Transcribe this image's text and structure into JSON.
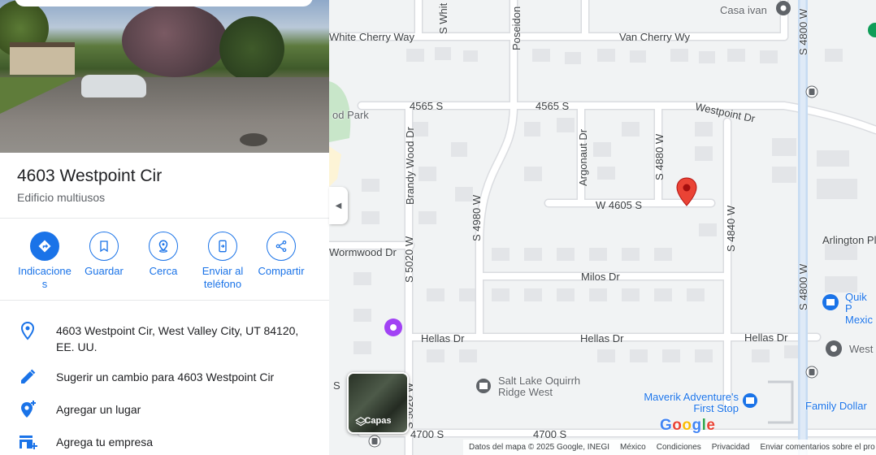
{
  "place": {
    "title": "4603 Westpoint Cir",
    "subtitle": "Edificio multiusos",
    "photo": "street-view-photo"
  },
  "actions": [
    {
      "label": "Indicaciones",
      "icon": "directions-icon"
    },
    {
      "label": "Guardar",
      "icon": "bookmark-icon"
    },
    {
      "label": "Cerca",
      "icon": "nearby-icon"
    },
    {
      "label": "Enviar al teléfono",
      "icon": "send-to-phone-icon"
    },
    {
      "label": "Compartir",
      "icon": "share-icon"
    }
  ],
  "info": {
    "address": "4603 Westpoint Cir, West Valley City, UT 84120, EE. UU.",
    "suggest_edit": "Sugerir un cambio para 4603 Westpoint Cir",
    "add_place": "Agregar un lugar",
    "add_business": "Agrega tu empresa"
  },
  "map": {
    "streets": {
      "white_cherry": "White Cherry Way",
      "van_cherry": "Van Cherry Wy",
      "s4565_a": "4565 S",
      "s4565_b": "4565 S",
      "westpoint": "Westpoint Dr",
      "w4605": "W 4605 S",
      "wormwood": "Wormwood Dr",
      "milos": "Milos Dr",
      "hellas_a": "Hellas Dr",
      "hellas_b": "Hellas Dr",
      "hellas_c": "Hellas Dr",
      "s4700_a": "4700 S",
      "s4700_b": "4700 S",
      "arlington": "Arlington Pl",
      "brandywood": "Brandy Wood Dr",
      "argonaut": "Argonaut Dr",
      "s4880": "S 4880 W",
      "s4980": "S 4980 W",
      "s5020_a": "S 5020 W",
      "s5020_b": "S 5020 W",
      "s4840": "S 4840 W",
      "s4800_a": "S 4800 W",
      "s4800_b": "S 4800 W",
      "poseidon": "Poseidon",
      "s_whit": "S Whit",
      "park": "od Park",
      "s_edge": "S"
    },
    "pois": {
      "casa_ivan": "Casa ivan",
      "salt_lake": "Salt Lake Oquirrh Ridge West",
      "maverik": "Maverik Adventure's First Stop",
      "family_dollar": "Family Dollar",
      "quik": "Quik P Mexic",
      "west": "West"
    },
    "layers_label": "Capas",
    "google_logo": "Google",
    "attribution": {
      "data": "Datos del mapa © 2025 Google, INEGI",
      "country": "México",
      "terms": "Condiciones",
      "privacy": "Privacidad",
      "feedback": "Enviar comentarios sobre el pro"
    },
    "colors": {
      "road": "#ffffff",
      "road_edge": "#dadce0",
      "major_road": "#c6dbf2",
      "park": "#c8e6c9",
      "pin": "#ea4335"
    }
  }
}
